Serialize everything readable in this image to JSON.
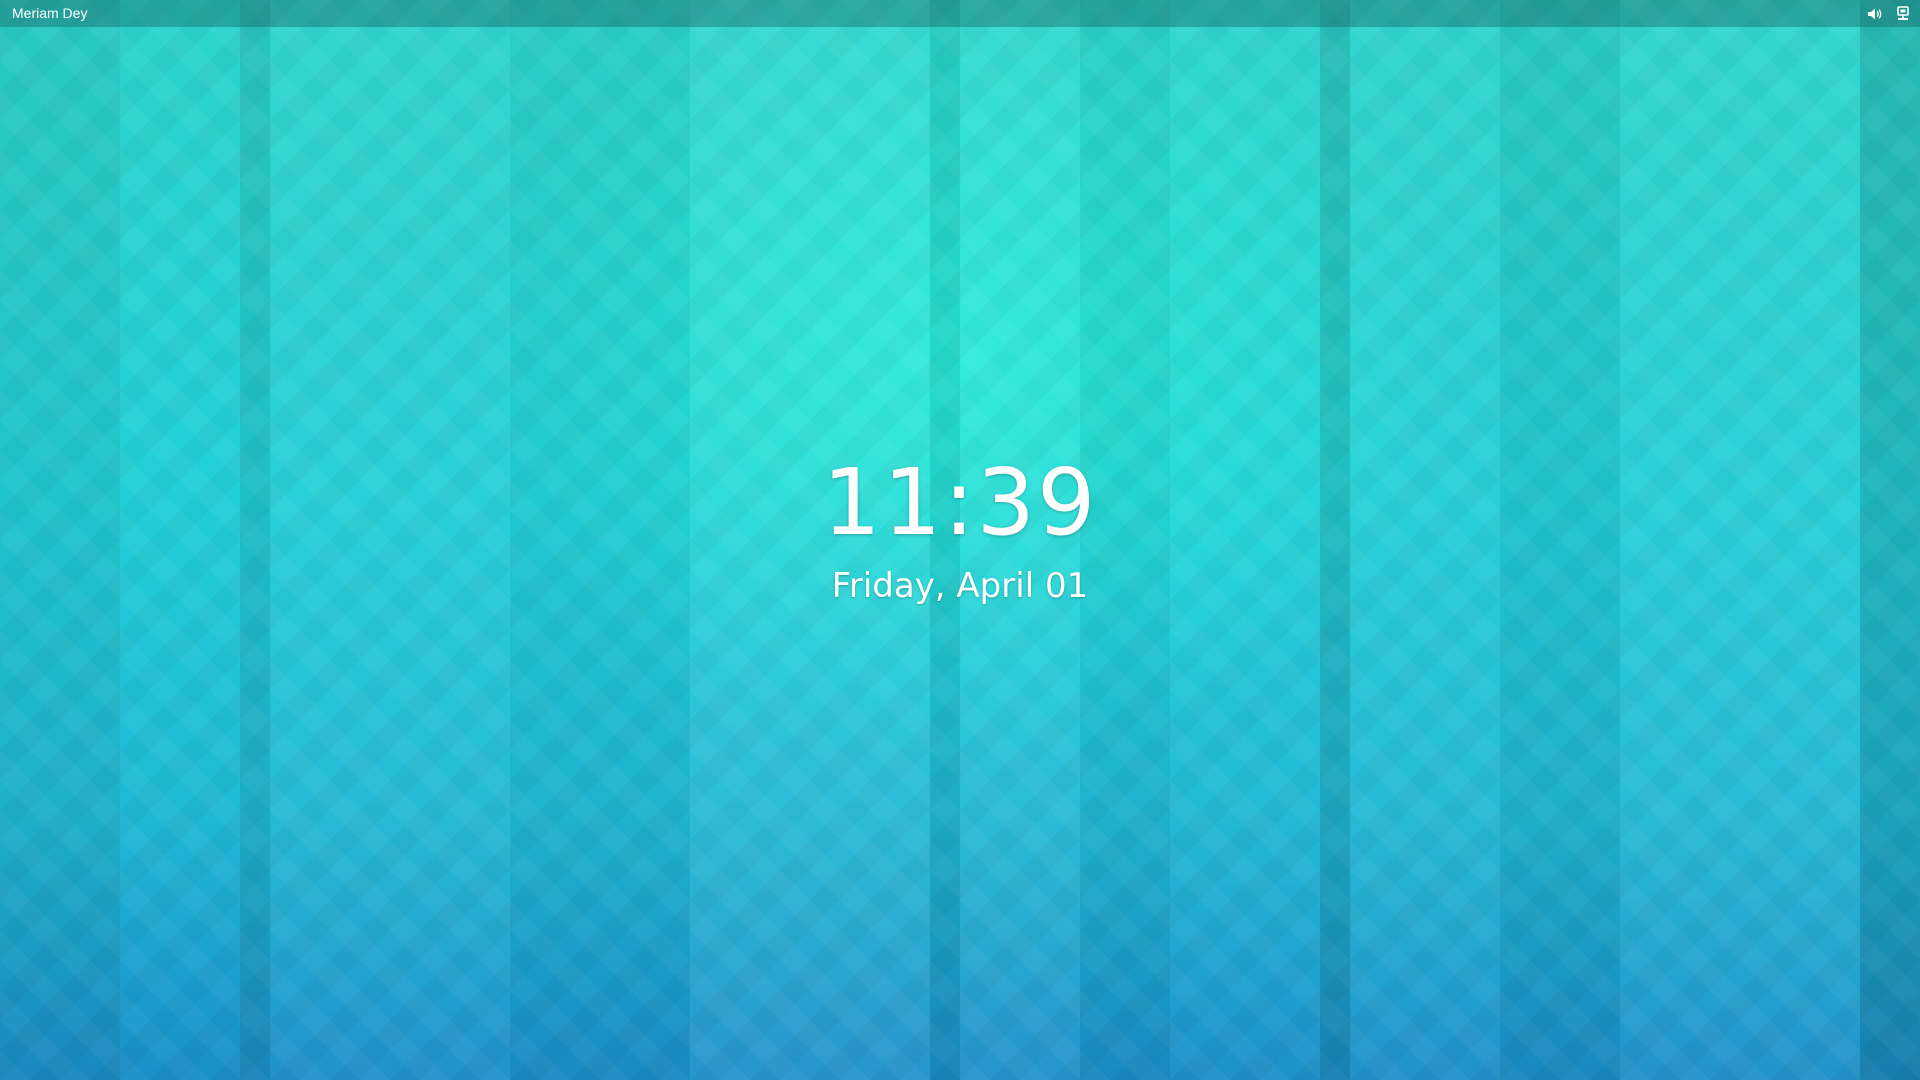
{
  "topbar": {
    "user_name": "Meriam Dey",
    "tray_icons": [
      "volume-icon",
      "network-icon"
    ]
  },
  "lock_screen": {
    "time": "11:39",
    "date": "Friday, April 01"
  },
  "colors": {
    "wallpaper_top": "#2cd4cc",
    "wallpaper_bottom": "#1a8fc8",
    "text": "#ffffff"
  }
}
